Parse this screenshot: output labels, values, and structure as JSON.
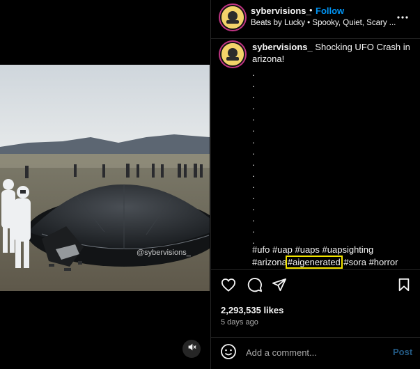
{
  "post": {
    "username": "sybervisions_",
    "separator": "•",
    "follow_label": "Follow",
    "audio": "Beats by Lucky • Spooky, Quiet, Scary ...",
    "caption_text": "Shocking UFO Crash in arizona!",
    "caption_dots": [
      ".",
      ".",
      ".",
      ".",
      ".",
      ".",
      ".",
      ".",
      ".",
      ".",
      ".",
      ".",
      ".",
      ".",
      ".",
      "."
    ],
    "hashtags": [
      "#ufo",
      "#uap",
      "#uaps",
      "#uapsighting",
      "#arizona",
      "#aigenerated",
      "#sora",
      "#horror"
    ],
    "highlighted_hashtag": "#aigenerated",
    "likes": "2,293,535 likes",
    "posted_time": "5 days ago"
  },
  "media": {
    "watermark": "@sybervisions_",
    "mute_icon": "speaker-muted-icon"
  },
  "actions": {
    "icons": [
      "heart-icon",
      "comment-icon",
      "share-icon",
      "bookmark-icon"
    ]
  },
  "comment": {
    "placeholder": "Add a comment...",
    "post_label": "Post",
    "emoji_icon": "emoji-icon"
  },
  "colors": {
    "background": "#000000",
    "link_blue": "#0095f6",
    "post_disabled": "#235a84",
    "highlight_box": "#f5e600",
    "muted_text": "#a8a8a8"
  }
}
